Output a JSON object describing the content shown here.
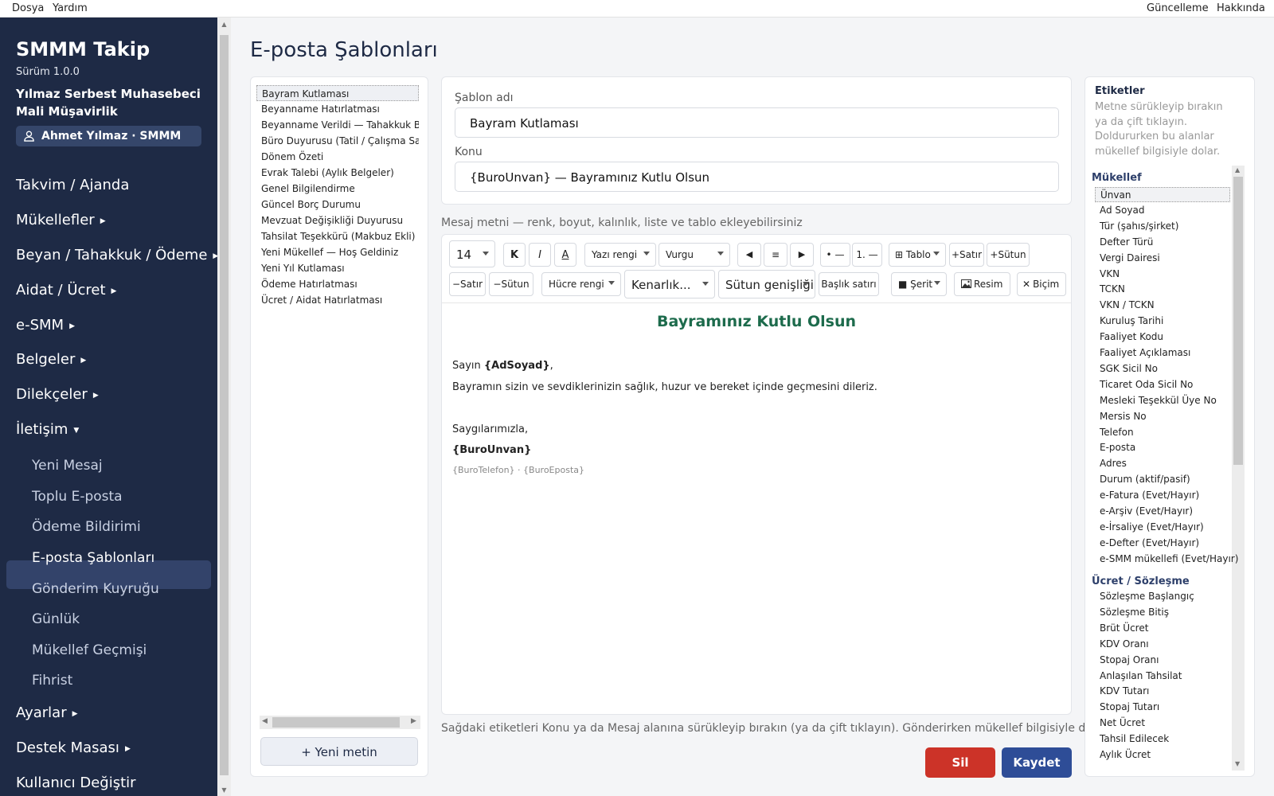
{
  "menubar": {
    "file": "Dosya",
    "help": "Yardım",
    "update": "Güncelleme",
    "about": "Hakkında"
  },
  "sidebar": {
    "app_title": "SMMM Takip",
    "version": "Sürüm 1.0.0",
    "firm_name": "Yılmaz Serbest Muhasebeci Mali Müşavirlik",
    "user": "Ahmet Yılmaz · SMMM",
    "nav": [
      {
        "label": "Takvim / Ajanda",
        "arrow": ""
      },
      {
        "label": "Mükellefler",
        "arrow": "▶"
      },
      {
        "label": "Beyan / Tahakkuk / Ödeme",
        "arrow": "▶"
      },
      {
        "label": "Aidat / Ücret",
        "arrow": "▶"
      },
      {
        "label": "e-SMM",
        "arrow": "▶"
      },
      {
        "label": "Belgeler",
        "arrow": "▶"
      },
      {
        "label": "Dilekçeler",
        "arrow": "▶"
      },
      {
        "label": "İletişim",
        "arrow": "▼"
      }
    ],
    "sub_nav": [
      "Yeni Mesaj",
      "Toplu E-posta",
      "Ödeme Bildirimi",
      "E-posta Şablonları",
      "Gönderim Kuyruğu",
      "Günlük",
      "Mükellef Geçmişi",
      "Fihrist"
    ],
    "nav_bottom": [
      {
        "label": "Ayarlar",
        "arrow": "▶"
      },
      {
        "label": "Destek Masası",
        "arrow": "▶"
      },
      {
        "label": "Kullanıcı Değiştir",
        "arrow": ""
      }
    ]
  },
  "page_title": "E-posta Şablonları",
  "templates": {
    "items": [
      "Bayram Kutlaması",
      "Beyanname Hatırlatması",
      "Beyanname Verildi — Tahakkuk Bilgisi",
      "Büro Duyurusu (Tatil / Çalışma Saatleri)",
      "Dönem Özeti",
      "Evrak Talebi (Aylık Belgeler)",
      "Genel Bilgilendirme",
      "Güncel Borç Durumu",
      "Mevzuat Değişikliği Duyurusu",
      "Tahsilat Teşekkürü (Makbuz Ekli)",
      "Yeni Mükellef — Hoş Geldiniz",
      "Yeni Yıl Kutlaması",
      "Ödeme Hatırlatması",
      "Ücret / Aidat Hatırlatması"
    ],
    "new_button": "+ Yeni metin"
  },
  "form": {
    "name_label": "Şablon adı",
    "name_value": "Bayram Kutlaması",
    "subject_label": "Konu",
    "subject_value": "{BuroUnvan} — Bayramınız Kutlu Olsun"
  },
  "message_label": "Mesaj metni — renk, boyut, kalınlık, liste ve tablo ekleyebilirsiniz",
  "toolbar": {
    "font_size": "14",
    "bold": "K",
    "italic": "I",
    "underline": "A",
    "text_color": "Yazı rengi",
    "highlight": "Vurgu",
    "align_left": "◀",
    "align_center": "≡",
    "align_right": "▶",
    "bullet_list": "• —",
    "numbered_list": "1. —",
    "table": "⊞ Tablo",
    "add_row": "+Satır",
    "add_col": "+Sütun",
    "del_row": "−Satır",
    "del_col": "−Sütun",
    "cell_color": "Hücre rengi",
    "borders": "Kenarlık...",
    "col_width": "Sütun genişliği...",
    "header_row": "Başlık satırı",
    "stripe": "■ Şerit",
    "image": "Resim",
    "clear_format": "Biçim"
  },
  "editor": {
    "heading": "Bayramınız Kutlu Olsun",
    "greeting_prefix": "Sayın ",
    "greeting_tag": "{AdSoyad}",
    "greeting_suffix": ",",
    "body": "Bayramın sizin ve sevdiklerinizin sağlık, huzur ve bereket içinde geçmesini dileriz.",
    "closing": "Saygılarımızla,",
    "signature": "{BuroUnvan}",
    "footer": "{BuroTelefon}  ·  {BuroEposta}"
  },
  "hint": "Sağdaki etiketleri Konu ya da Mesaj alanına sürükleyip bırakın (ya da çift tıklayın). Gönderirken mükellef bilgisiyle dolar.",
  "actions": {
    "delete": "Sil",
    "save": "Kaydet"
  },
  "tags": {
    "title": "Etiketler",
    "description": "Metne sürükleyip bırakın ya da çift tıklayın. Doldururken bu alanlar mükellef bilgisiyle dolar.",
    "group1": "Mükellef",
    "group1_items": [
      "Ünvan",
      "Ad Soyad",
      "Tür (şahıs/şirket)",
      "Defter Türü",
      "Vergi Dairesi",
      "VKN",
      "TCKN",
      "VKN / TCKN",
      "Kuruluş Tarihi",
      "Faaliyet Kodu",
      "Faaliyet Açıklaması",
      "SGK Sicil No",
      "Ticaret Oda Sicil No",
      "Mesleki Teşekkül Üye No",
      "Mersis No",
      "Telefon",
      "E-posta",
      "Adres",
      "Durum (aktif/pasif)",
      "e-Fatura (Evet/Hayır)",
      "e-Arşiv (Evet/Hayır)",
      "e-İrsaliye (Evet/Hayır)",
      "e-Defter (Evet/Hayır)",
      "e-SMM mükellefi (Evet/Hayır)"
    ],
    "group2": "Ücret / Sözleşme",
    "group2_items": [
      "Sözleşme Başlangıç",
      "Sözleşme Bitiş",
      "Brüt Ücret",
      "KDV Oranı",
      "Stopaj Oranı",
      "Anlaşılan Tahsilat",
      "KDV Tutarı",
      "Stopaj Tutarı",
      "Net Ücret",
      "Tahsil Edilecek",
      "Aylık Ücret"
    ]
  },
  "colors": {
    "sidebar": "#1e2a45",
    "heading_green": "#1d6b4c",
    "delete": "#cc3328",
    "save": "#2e4d97"
  }
}
